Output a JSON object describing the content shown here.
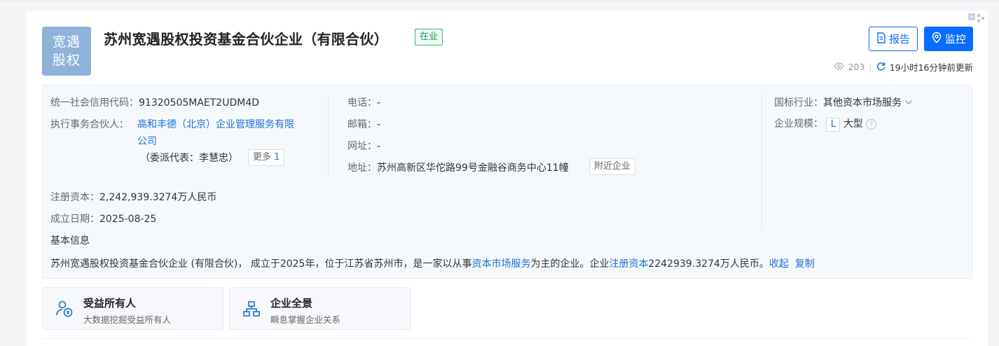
{
  "header": {
    "logo_line1": "宽遇",
    "logo_line2": "股权",
    "company_name": "苏州宽遇股权投资基金合伙企业（有限合伙）",
    "status": "在业",
    "corner_mark": "ᗡᑭ",
    "report_label": "报告",
    "monitor_label": "监控",
    "views": "203",
    "updated": "19小时16分钟前更新"
  },
  "info": {
    "credit_code_label": "统一社会信用代码：",
    "credit_code": "91320505MAET2UDM4D",
    "partner_label": "执行事务合伙人：",
    "partner_name_line1": "高和丰德（北京）企业管理服务有限",
    "partner_name_line2": "公司",
    "delegate": "（委派代表：李慧忠）",
    "more_label": "更多",
    "more_count": "1",
    "phone_label": "电话：",
    "phone": "-",
    "email_label": "邮箱：",
    "email": "-",
    "website_label": "网址：",
    "website": "-",
    "address_label": "地址：",
    "address": "苏州高新区华佗路99号金融谷商务中心11幢",
    "nearby_label": "附近企业",
    "industry_label": "国标行业：",
    "industry": "其他资本市场服务",
    "scale_label": "企业规模：",
    "scale_letter": "L",
    "scale": "大型",
    "capital_label": "注册资本：",
    "capital": "2,242,939.3274万人民币",
    "founded_label": "成立日期：",
    "founded": "2025-08-25",
    "basic_info_label": "基本信息",
    "summary_part1": "苏州宽遇股权投资基金合伙企业 (有限合伙)， 成立于2025年，位于江苏省苏州市，是一家以从事",
    "summary_link1": "资本市场服务",
    "summary_part2": "为主的企业。企业",
    "summary_link2": "注册资本",
    "summary_part3": "2242939.3274万人民币。",
    "collapse_label": "收起",
    "copy_label": "复制"
  },
  "tiles": [
    {
      "title": "受益所有人",
      "subtitle": "大数据挖掘受益所有人",
      "icon": "beneficiary-icon"
    },
    {
      "title": "企业全景",
      "subtitle": "瞬息掌握企业关系",
      "icon": "org-chart-icon"
    }
  ],
  "colors": {
    "accent": "#0a6cff",
    "link": "#1a6fd6",
    "status_green": "#1f9d55",
    "logo_bg": "#8eb2da"
  }
}
